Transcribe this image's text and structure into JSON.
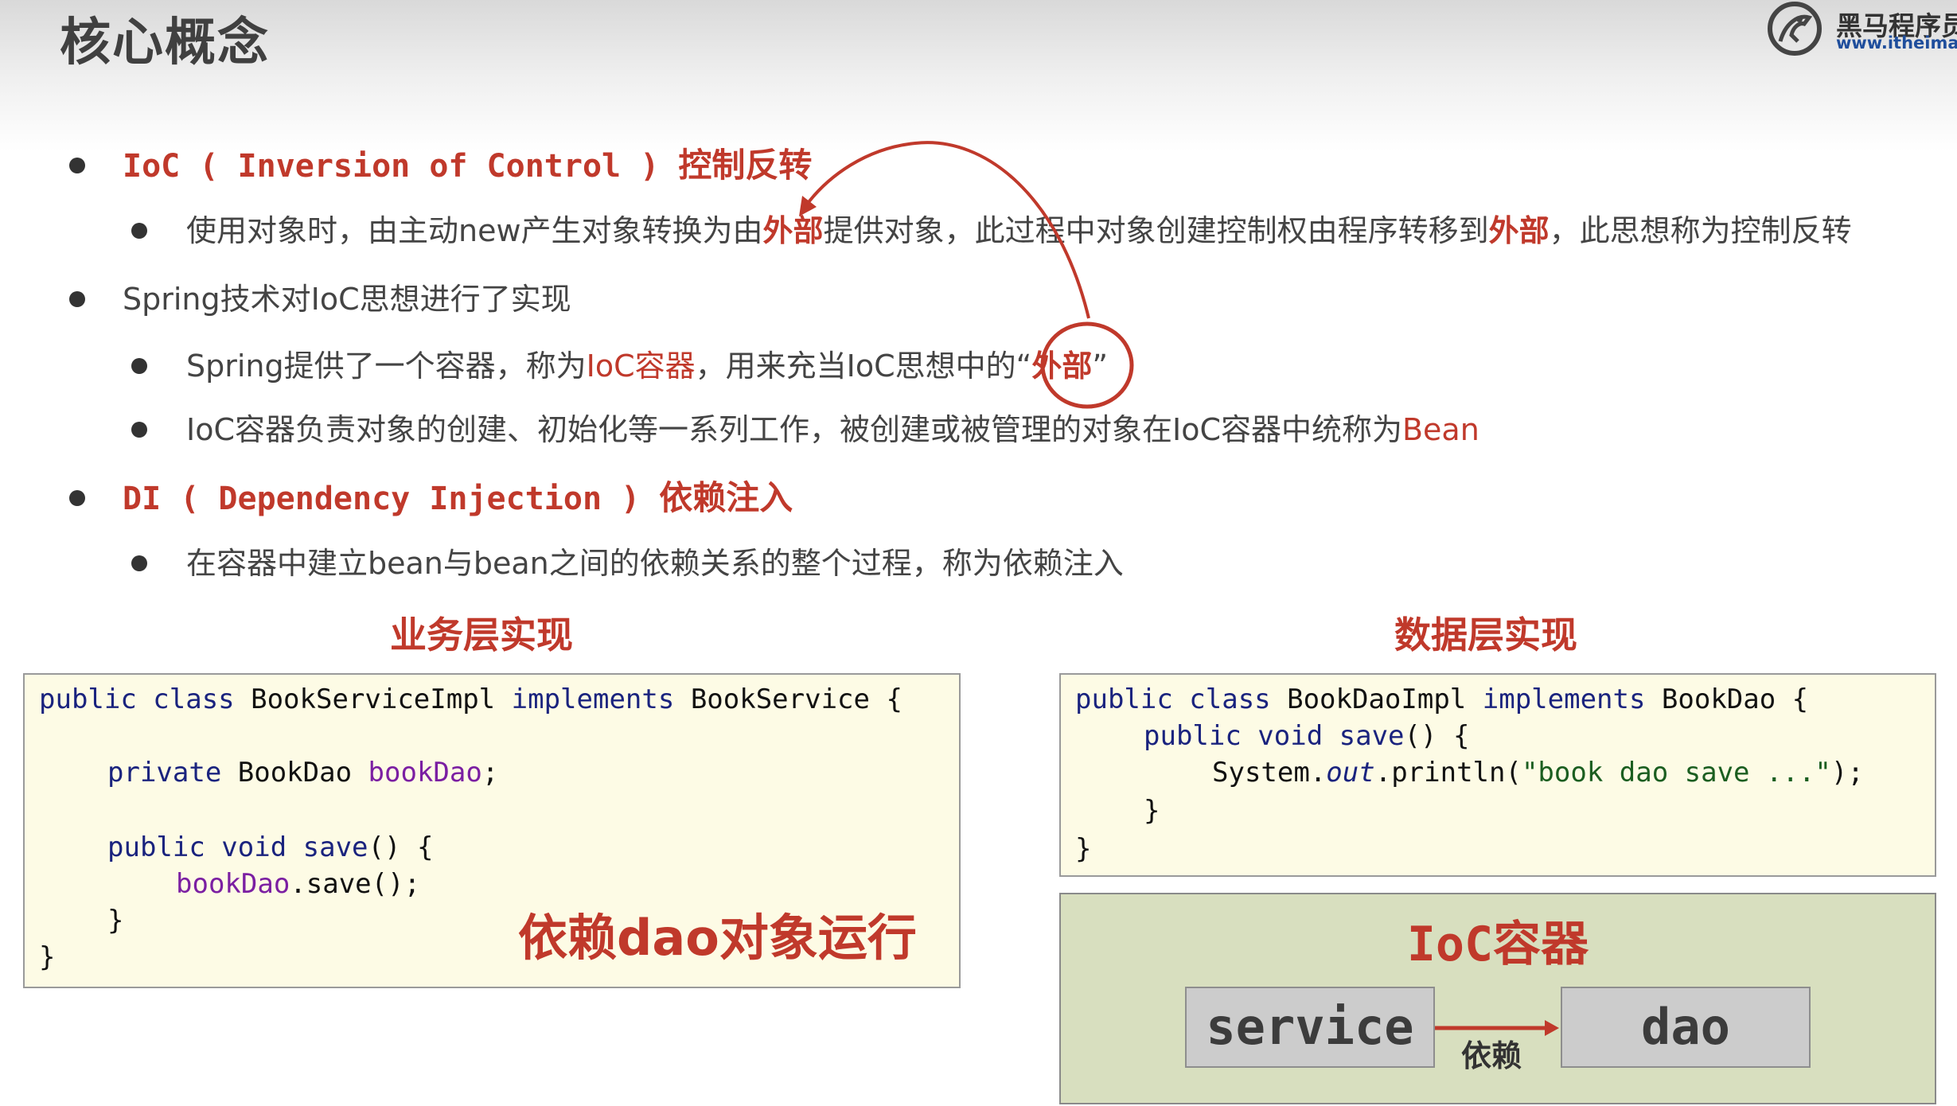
{
  "header": {
    "title": "核心概念",
    "logo_cn": "黑马程序员",
    "logo_url": "www.itheima.com"
  },
  "points": {
    "ioc_head_en": "IoC ( Inversion of Control ) ",
    "ioc_head_cn": "控制反转",
    "ioc_desc_1": "使用对象时，由主动new产生对象转换为由",
    "ioc_desc_outer_1": "外部",
    "ioc_desc_2": "提供对象，此过程中对象创建控制权由程序转移到",
    "ioc_desc_outer_2": "外部",
    "ioc_desc_3": "，此思想称为控制反转",
    "spring_head": "Spring技术对IoC思想进行了实现",
    "spring_sub1_a": "Spring提供了一个容器，称为",
    "spring_sub1_container": "IoC容器",
    "spring_sub1_b": "，用来充当IoC思想中的“",
    "spring_sub1_outer": "外部",
    "spring_sub1_c": "”",
    "spring_sub2_a": "IoC容器负责对象的创建、初始化等一系列工作，被创建或被管理的对象在IoC容器中统称为",
    "spring_sub2_bean": "Bean",
    "di_head_en": "DI ( Dependency Injection ) ",
    "di_head_cn": "依赖注入",
    "di_desc": "在容器中建立bean与bean之间的依赖关系的整个过程，称为依赖注入"
  },
  "service_section": {
    "title": "业务层实现",
    "callout": "依赖dao对象运行",
    "code": {
      "l1_kw": "public class",
      "l1_name": " BookServiceImpl ",
      "l1_impl": "implements",
      "l1_rest": " BookService {",
      "l2_kw": "private",
      "l2_type": " BookDao ",
      "l2_field": "bookDao",
      "l2_end": ";",
      "l3_kw": "public void",
      "l3_method": " save",
      "l3_rest": "() {",
      "l4_field": "bookDao",
      "l4_rest": ".save();",
      "l5": "}",
      "l6": "}"
    }
  },
  "dao_section": {
    "title": "数据层实现",
    "code": {
      "l1_kw": "public class",
      "l1_name": " BookDaoImpl ",
      "l1_impl": "implements",
      "l1_rest": " BookDao {",
      "l2_kw": "public void",
      "l2_method": " save",
      "l2_rest": "() {",
      "l3_a": "System.",
      "l3_out": "out",
      "l3_b": ".println(",
      "l3_str": "\"book dao save ...\"",
      "l3_c": ");",
      "l4": "}",
      "l5": "}"
    }
  },
  "ioc_container": {
    "title": "IoC容器",
    "service": "service",
    "dao": "dao",
    "dependency": "依赖"
  }
}
